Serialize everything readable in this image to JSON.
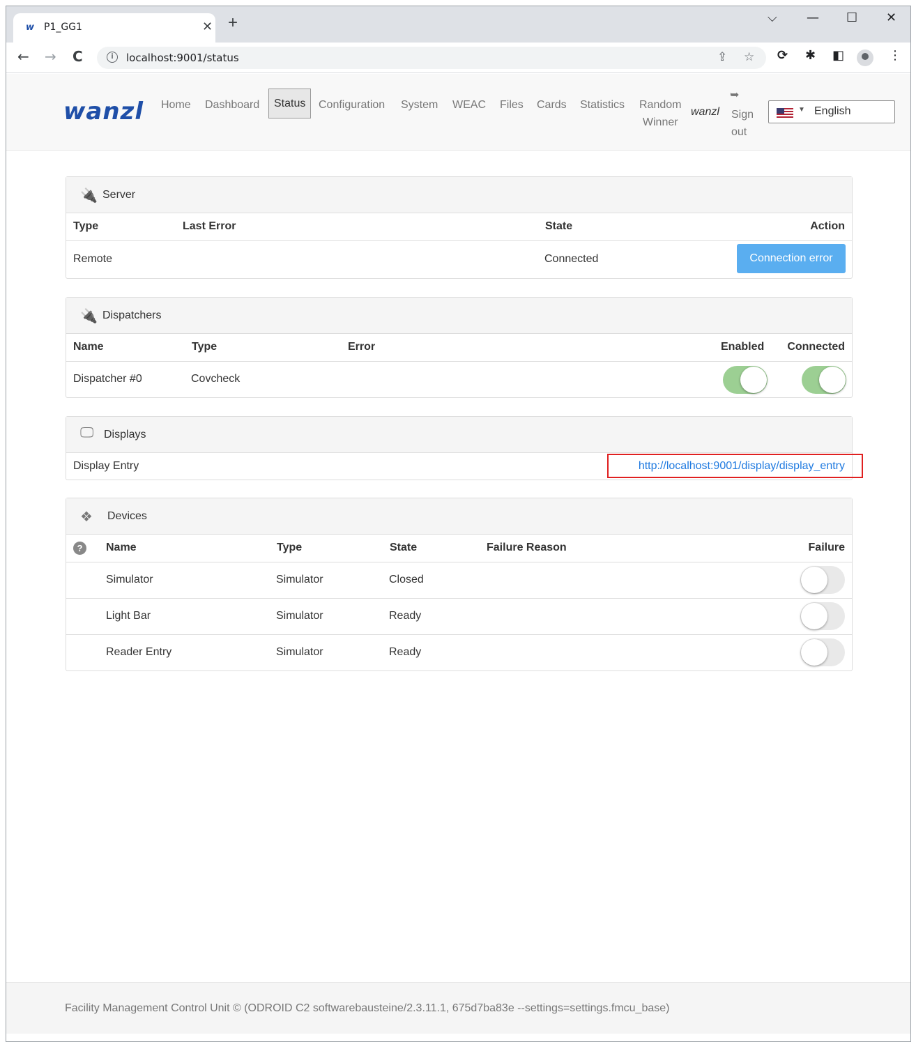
{
  "browser": {
    "tab_favicon": "w",
    "tab_title": "P1_GG1",
    "tab_close": "✕",
    "new_tab": "+",
    "url": "localhost:9001/status",
    "window_controls": [
      "⌵",
      "—",
      "☐",
      "✕"
    ],
    "nav": {
      "back": "←",
      "forward": "→",
      "reload": "C"
    },
    "icons": [
      "share-icon",
      "star-icon",
      "sync-icon",
      "extensions-icon",
      "sidepanel-icon",
      "profile-icon",
      "menu-icon"
    ]
  },
  "nav": {
    "logo": "wanzl",
    "items": [
      "Home",
      "Dashboard",
      "Status",
      "Configuration",
      "System",
      "WEAC",
      "Files",
      "Cards",
      "Statistics"
    ],
    "random_line1": "Random",
    "random_line2": "Winner",
    "active": "Status",
    "user": "wanzl",
    "signout_line1": "Sign",
    "signout_line2": "out",
    "language": "English"
  },
  "server": {
    "title": "Server",
    "headers": {
      "type": "Type",
      "last_error": "Last Error",
      "state": "State",
      "action": "Action"
    },
    "row": {
      "type": "Remote",
      "last_error": "",
      "state": "Connected",
      "action": "Connection error"
    }
  },
  "dispatchers": {
    "title": "Dispatchers",
    "headers": {
      "name": "Name",
      "type": "Type",
      "error": "Error",
      "enabled": "Enabled",
      "connected": "Connected"
    },
    "row": {
      "name": "Dispatcher #0",
      "type": "Covcheck",
      "error": "",
      "enabled": true,
      "connected": true
    }
  },
  "displays": {
    "title": "Displays",
    "row": {
      "name": "Display Entry",
      "link": "http://localhost:9001/display/display_entry"
    }
  },
  "devices": {
    "title": "Devices",
    "headers": {
      "help": "?",
      "name": "Name",
      "type": "Type",
      "state": "State",
      "failure_reason": "Failure Reason",
      "failure": "Failure"
    },
    "rows": [
      {
        "name": "Simulator",
        "type": "Simulator",
        "state": "Closed",
        "failure": false
      },
      {
        "name": "Light Bar",
        "type": "Simulator",
        "state": "Ready",
        "failure": false
      },
      {
        "name": "Reader Entry",
        "type": "Simulator",
        "state": "Ready",
        "failure": false
      }
    ]
  },
  "footer": {
    "text": "Facility Management Control Unit © (ODROID C2 softwarebausteine/2.3.11.1, 675d7ba83e --settings=settings.fmcu_base)"
  },
  "colors": {
    "brand": "#1f4fa8",
    "button": "#5aaef0",
    "toggle_on": "#9ccf93",
    "link": "#1f7ae0",
    "highlight": "#e02020"
  }
}
